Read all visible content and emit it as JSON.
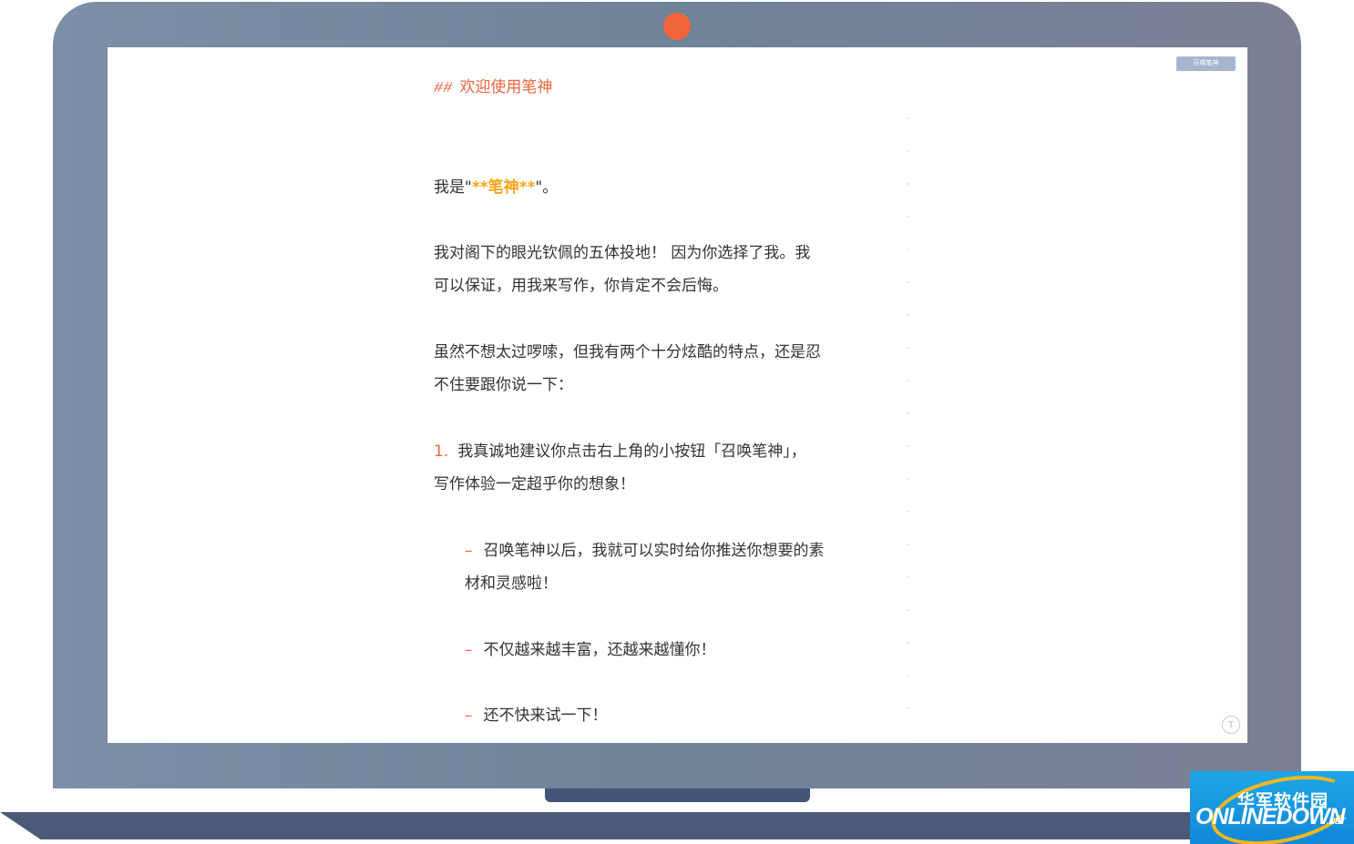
{
  "toolbar": {
    "summon_label": "召唤笔神"
  },
  "editor": {
    "heading_hash": "##",
    "heading_text": "欢迎使用笔神",
    "p1_prefix": "我是\"",
    "p1_bold": "**笔神**",
    "p1_suffix": "\"。",
    "p2_line1": "我对阁下的眼光钦佩的五体投地！  因为你选择了我。我",
    "p2_line2": "可以保证，用我来写作，你肯定不会后悔。",
    "p3_line1": "虽然不想太过啰嗦，但我有两个十分炫酷的特点，还是忍",
    "p3_line2": "不住要跟你说一下：",
    "li1_number": "1.",
    "li1_line1": "我真诚地建议你点击右上角的小按钮「召唤笔神」，",
    "li1_line2": "写作体验一定超乎你的想象！",
    "sub_dash": "–",
    "sub1_line1": "召唤笔神以后，我就可以实时给你推送你想要的素",
    "sub1_line2": "材和灵感啦！",
    "sub2": "不仅越来越丰富，还越来越懂你！",
    "sub3": "还不快来试一下！"
  },
  "corner_icon": {
    "icon": "t-circle-icon",
    "glyph": "T"
  },
  "watermark": {
    "cn": "华军软件园",
    "en": "ONLINEDOWN",
    "net": ".NET"
  },
  "colors": {
    "accent": "#f0643c",
    "bold_highlight": "#f7a317",
    "laptop_frame": "#7387a0",
    "button": "#a7b5d1"
  }
}
